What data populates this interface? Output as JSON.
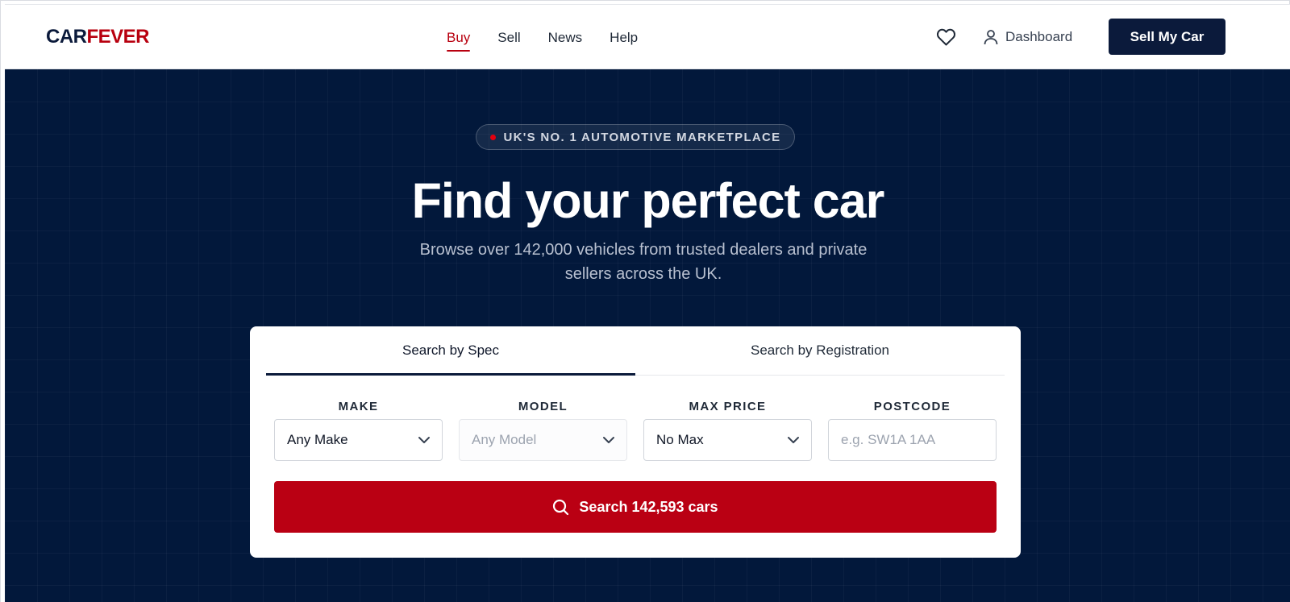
{
  "header": {
    "logo": {
      "part1": "CAR",
      "part2": "FEVER"
    },
    "nav": [
      {
        "label": "Buy",
        "active": true
      },
      {
        "label": "Sell",
        "active": false
      },
      {
        "label": "News",
        "active": false
      },
      {
        "label": "Help",
        "active": false
      }
    ],
    "favorites_icon": "heart-icon",
    "dashboard_label": "Dashboard",
    "dashboard_icon": "user-icon",
    "sell_button": "Sell My Car"
  },
  "hero": {
    "badge": "UK'S NO. 1 AUTOMOTIVE MARKETPLACE",
    "title": "Find your perfect car",
    "subtitle": "Browse over 142,000 vehicles from trusted dealers and private sellers across the UK."
  },
  "search": {
    "tabs": [
      {
        "label": "Search by Spec",
        "active": true
      },
      {
        "label": "Search by Registration",
        "active": false
      }
    ],
    "fields": {
      "make": {
        "label": "MAKE",
        "value": "Any Make"
      },
      "model": {
        "label": "MODEL",
        "value": "Any Model",
        "disabled": true
      },
      "max_price": {
        "label": "MAX PRICE",
        "value": "No Max"
      },
      "postcode": {
        "label": "POSTCODE",
        "placeholder": "e.g. SW1A 1AA",
        "value": ""
      }
    },
    "button_label": "Search 142,593 cars",
    "button_icon": "search-icon"
  },
  "colors": {
    "brand_navy": "#0b1a3b",
    "brand_red": "#b8000f",
    "hero_bg": "#02183b",
    "button_red": "#ba0013"
  }
}
